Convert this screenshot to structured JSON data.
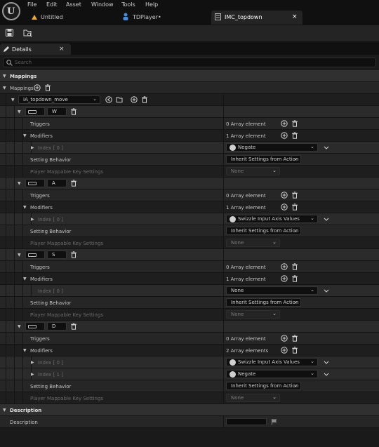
{
  "menu": [
    "File",
    "Edit",
    "Asset",
    "Window",
    "Tools",
    "Help"
  ],
  "tabs": [
    {
      "label": "Untitled"
    },
    {
      "label": "TDPlayer•"
    },
    {
      "label": "IMC_topdown",
      "close": "×"
    }
  ],
  "details": {
    "tab_label": "Details",
    "close": "×",
    "search_placeholder": "Search"
  },
  "mappings_category": "Mappings",
  "mappings_label": "Mappings",
  "action": {
    "value": "IA_topdown_move"
  },
  "labels": {
    "triggers": "Triggers",
    "modifiers": "Modifiers",
    "setting_behavior": "Setting Behavior",
    "player_mappable": "Player Mappable Key Settings"
  },
  "keys": [
    {
      "key": "W",
      "triggers": "0 Array element",
      "modifiers": "1 Array element",
      "setting": "Inherit Settings from Action",
      "player": "None",
      "mods": [
        {
          "index": "Index [ 0 ]",
          "value": "Negate",
          "has_icon": true,
          "expandable": true
        }
      ]
    },
    {
      "key": "A",
      "triggers": "0 Array element",
      "modifiers": "1 Array element",
      "setting": "Inherit Settings from Action",
      "player": "None",
      "mods": [
        {
          "index": "Index [ 0 ]",
          "value": "Swizzle Input Axis Values",
          "has_icon": true,
          "expandable": true
        }
      ]
    },
    {
      "key": "S",
      "triggers": "0 Array element",
      "modifiers": "1 Array element",
      "setting": "Inherit Settings from Action",
      "player": "None",
      "mods": [
        {
          "index": "Index [ 0 ]",
          "value": "None",
          "has_icon": false,
          "expandable": false
        }
      ]
    },
    {
      "key": "D",
      "triggers": "0 Array element",
      "modifiers": "2 Array elements",
      "setting": "Inherit Settings from Action",
      "player": "None",
      "mods": [
        {
          "index": "Index [ 0 ]",
          "value": "Swizzle Input Axis Values",
          "has_icon": true,
          "expandable": true
        },
        {
          "index": "Index [ 1 ]",
          "value": "Negate",
          "has_icon": true,
          "expandable": true
        }
      ]
    }
  ],
  "description_category": "Description",
  "description_label": "Description",
  "description_value": ""
}
